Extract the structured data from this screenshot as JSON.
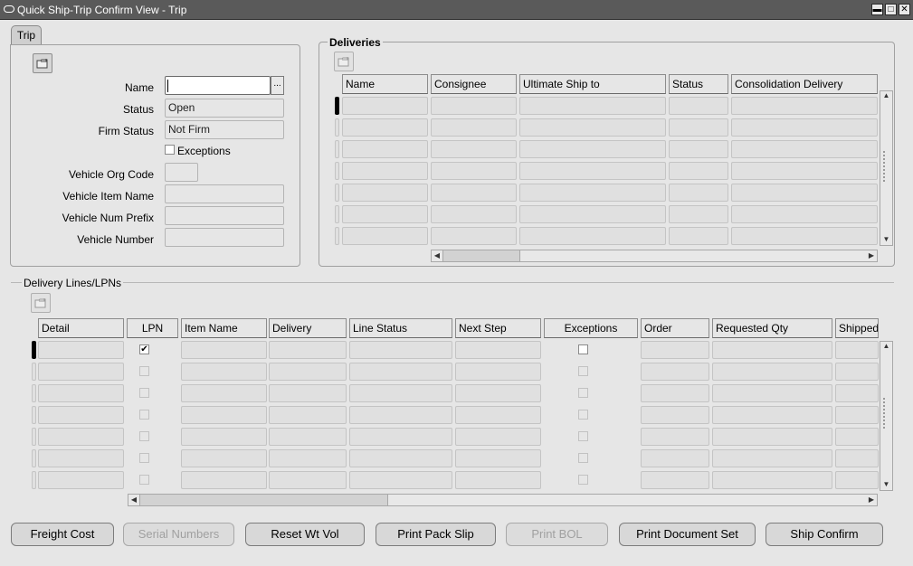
{
  "window": {
    "title": "Quick Ship-Trip Confirm View - Trip",
    "controls": [
      "minimize-icon",
      "maximize-icon",
      "close-icon"
    ]
  },
  "tabs": [
    {
      "label": "Trip",
      "active": true
    }
  ],
  "trip": {
    "fields": {
      "name": {
        "label": "Name",
        "value": ""
      },
      "status": {
        "label": "Status",
        "value": "Open"
      },
      "firm_status": {
        "label": "Firm Status",
        "value": "Not Firm"
      },
      "exceptions": {
        "label": "Exceptions",
        "checked": false
      },
      "vehicle_org_code": {
        "label": "Vehicle Org Code",
        "value": ""
      },
      "vehicle_item_name": {
        "label": "Vehicle Item Name",
        "value": ""
      },
      "vehicle_num_prefix": {
        "label": "Vehicle Num Prefix",
        "value": ""
      },
      "vehicle_number": {
        "label": "Vehicle Number",
        "value": ""
      }
    },
    "lov_label": "..."
  },
  "deliveries": {
    "title": "Deliveries",
    "columns": [
      "Name",
      "Consignee",
      "Ultimate Ship to",
      "Status",
      "Consolidation Delivery"
    ],
    "visible_rows": 7
  },
  "lines": {
    "title": "Delivery Lines/LPNs",
    "columns": [
      "Detail",
      "LPN",
      "Item Name",
      "Delivery",
      "Line Status",
      "Next Step",
      "Exceptions",
      "Order",
      "Requested Qty",
      "Shipped"
    ],
    "visible_rows": 7,
    "first_row_lpn_checked": true,
    "check_mark": "✔"
  },
  "buttons": [
    {
      "label": "Freight Cost",
      "enabled": true
    },
    {
      "label": "Serial Numbers",
      "enabled": false
    },
    {
      "label": "Reset Wt Vol",
      "enabled": true
    },
    {
      "label": "Print Pack Slip",
      "enabled": true
    },
    {
      "label": "Print BOL",
      "enabled": false
    },
    {
      "label": "Print Document Set",
      "enabled": true
    },
    {
      "label": "Ship Confirm",
      "enabled": true
    }
  ],
  "colors": {
    "titlebar": "#5a5a5a",
    "background": "#e6e6e6",
    "field": "#e0e0e0"
  }
}
